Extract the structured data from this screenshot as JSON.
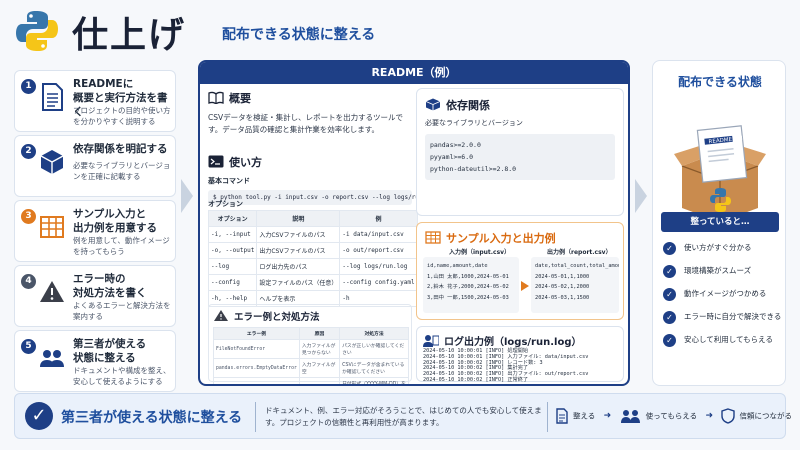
{
  "header": {
    "title": "仕上げ",
    "subtitle": "配布できる状態に整える"
  },
  "steps": [
    {
      "num": "1",
      "color": "#1e3f86",
      "title": "READMEに\n概要と実行方法を書く",
      "desc": "プロジェクトの目的や使い方を分かりやすく説明する",
      "icon": "document-icon"
    },
    {
      "num": "2",
      "color": "#1e3f86",
      "title": "依存関係を明記する",
      "desc": "必要なライブラリとバージョンを正確に記載する",
      "icon": "package-icon"
    },
    {
      "num": "3",
      "color": "#e07a1f",
      "title": "サンプル入力と\n出力例を用意する",
      "desc": "例を用意して、動作イメージを持ってもらう",
      "icon": "table-icon"
    },
    {
      "num": "4",
      "color": "#4a5568",
      "title": "エラー時の\n対処方法を書く",
      "desc": "よくあるエラーと解決方法を案内する",
      "icon": "warning-icon"
    },
    {
      "num": "5",
      "color": "#1e3f86",
      "title": "第三者が使える\n状態に整える",
      "desc": "ドキュメントや構成を整え、安心して使えるようにする",
      "icon": "people-icon"
    }
  ],
  "readme": {
    "heading": "README（例）",
    "overview": {
      "title": "概要",
      "text": "CSVデータを検証・集計し、レポートを出力するツールです。データ品質の確認と集計作業を効率化します。"
    },
    "usage": {
      "title": "使い方",
      "basic_label": "基本コマンド",
      "command": "$ python tool.py -i input.csv -o report.csv --log logs/run.log",
      "options_label": "オプション",
      "options_headers": [
        "オプション",
        "説明",
        "例"
      ],
      "options_rows": [
        [
          "-i, --input",
          "入力CSVファイルのパス",
          "-i data/input.csv"
        ],
        [
          "-o, --output",
          "出力CSVファイルのパス",
          "-o out/report.csv"
        ],
        [
          "--log",
          "ログ出力先のパス",
          "--log logs/run.log"
        ],
        [
          "--config",
          "設定ファイルのパス（任意）",
          "--config config.yaml"
        ],
        [
          "-h, --help",
          "ヘルプを表示",
          "-h"
        ]
      ]
    },
    "errors": {
      "title": "エラー例と対処方法",
      "headers": [
        "エラー例",
        "原因",
        "対処方法"
      ],
      "rows": [
        [
          "FileNotFoundError",
          "入力ファイルが見つからない",
          "パスが正しいか確認してください"
        ],
        [
          "pandas.errors.EmptyDataError",
          "入力ファイルが空",
          "CSVにデータが含まれているか確認してください"
        ],
        [
          "ValueError: Invalid date",
          "日付形式が不正",
          "日付形式（YYYY-MM-DD）を確認してください"
        ]
      ]
    },
    "deps": {
      "title": "依存関係",
      "subtitle": "必要なライブラリとバージョン",
      "lines": [
        "pandas>=2.0.0",
        "pyyaml>=6.0",
        "python-dateutil>=2.8.0"
      ]
    },
    "sample": {
      "title": "サンプル入力と出力例",
      "input_label": "入力例（input.csv）",
      "output_label": "出力例（report.csv）",
      "input_lines": [
        "id,name,amount,date",
        "1,山田 太郎,1000,2024-05-01",
        "2,鈴木 花子,2000,2024-05-02",
        "3,田中 一郎,1500,2024-05-03"
      ],
      "output_lines": [
        "date,total_count,total_amount",
        "2024-05-01,1,1000",
        "2024-05-02,1,2000",
        "2024-05-03,1,1500"
      ]
    },
    "logs": {
      "title": "ログ出力例（logs/run.log）",
      "lines": [
        "2024-05-10 10:00:01 [INFO] 処理開始",
        "2024-05-10 10:00:01 [INFO] 入力ファイル: data/input.csv",
        "2024-05-10 10:00:02 [INFO] レコード数: 3",
        "2024-05-10 10:00:02 [INFO] 集計完了",
        "2024-05-10 10:00:02 [INFO] 出力ファイル: out/report.csv",
        "2024-05-10 10:00:02 [INFO] 正常終了"
      ]
    }
  },
  "ready": {
    "title": "配布できる状態",
    "box_label": "README.md",
    "good_title": "整っていると…",
    "items": [
      "使い方がすぐ分かる",
      "環境構築がスムーズ",
      "動作イメージがつかめる",
      "エラー時に自分で解決できる",
      "安心して利用してもらえる"
    ]
  },
  "footer": {
    "title": "第三者が使える状態に整える",
    "text": "ドキュメント、例、エラー対応がそろうことで、はじめての人でも安心して使えます。プロジェクトの信頼性と再利用性が高まります。",
    "flow": [
      "整える",
      "使ってもらえる",
      "信頼につながる"
    ]
  },
  "colors": {
    "accent": "#1e3f86",
    "orange": "#e07a1f"
  }
}
